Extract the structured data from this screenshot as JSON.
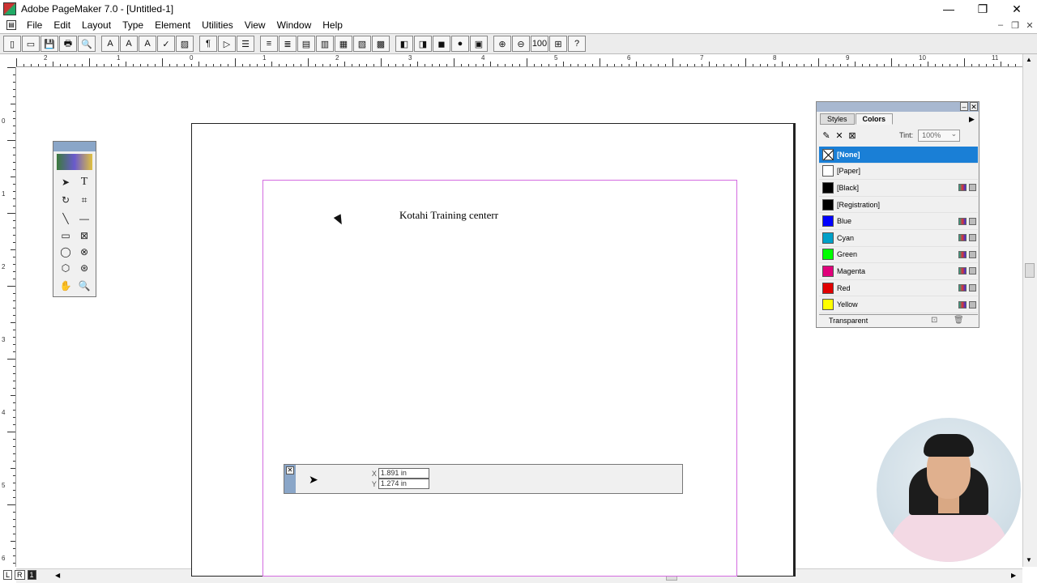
{
  "window": {
    "title": "Adobe PageMaker 7.0 - [Untitled-1]",
    "controls": [
      "—",
      "❐",
      "✕"
    ]
  },
  "menubar": {
    "items": [
      "File",
      "Edit",
      "Layout",
      "Type",
      "Element",
      "Utilities",
      "View",
      "Window",
      "Help"
    ]
  },
  "toolbar": {
    "buttons": [
      "▯",
      "▭",
      "💾",
      "🖶",
      "🔍",
      "A",
      "A",
      "A",
      "✓",
      "▨",
      "¶",
      "▷",
      "☰",
      "≡",
      "≣",
      "▤",
      "▥",
      "▦",
      "▧",
      "▩",
      "◧",
      "◨",
      "◼",
      "●",
      "▣",
      "⊕",
      "⊖",
      "100",
      "⊞",
      "?"
    ]
  },
  "ruler": {
    "horizontal_labels": [
      "2",
      "1",
      "0",
      "1",
      "2",
      "3",
      "4",
      "5",
      "6",
      "7",
      "8",
      "9",
      "10",
      "11"
    ],
    "vertical_labels": [
      "0",
      "1",
      "2",
      "3",
      "4",
      "5",
      "6"
    ]
  },
  "document": {
    "text": "Kotahi Training centerr"
  },
  "colors_panel": {
    "tabs": [
      "Styles",
      "Colors"
    ],
    "active_tab": "Colors",
    "tint_label": "Tint:",
    "tint_value": "100%",
    "colors": [
      {
        "name": "[None]",
        "hex": "none",
        "selected": true
      },
      {
        "name": "[Paper]",
        "hex": "#ffffff"
      },
      {
        "name": "[Black]",
        "hex": "#000000"
      },
      {
        "name": "[Registration]",
        "hex": "#000000"
      },
      {
        "name": "Blue",
        "hex": "#0000ff"
      },
      {
        "name": "Cyan",
        "hex": "#00a0c8"
      },
      {
        "name": "Green",
        "hex": "#00ff00"
      },
      {
        "name": "Magenta",
        "hex": "#e0007a"
      },
      {
        "name": "Red",
        "hex": "#e00000"
      },
      {
        "name": "Yellow",
        "hex": "#ffff00"
      }
    ],
    "footer_label": "Transparent"
  },
  "control_palette": {
    "x_label": "X",
    "x_value": "1.891 in",
    "y_label": "Y",
    "y_value": "1.274 in"
  },
  "page_icons": [
    "L",
    "R",
    "1"
  ]
}
